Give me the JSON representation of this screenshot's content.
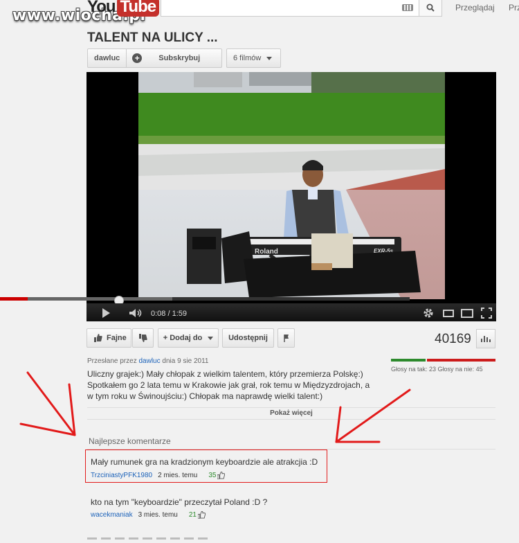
{
  "watermark": "www.wiocha.pl",
  "header": {
    "logo_you": "You",
    "logo_tube": "Tube",
    "search": {
      "value": "",
      "placeholder": ""
    },
    "nav": [
      "Przeglądaj",
      "Prz"
    ]
  },
  "video": {
    "title": "TALENT NA ULICY ...",
    "channel": "dawluc",
    "subscribe_label": "Subskrybuj",
    "videos_count_label": "6 filmów",
    "player": {
      "time_current": "0:08",
      "time_total": "1:59",
      "progress_fraction": 0.067,
      "buffered_fraction": 0.42,
      "keyboard_brand": "Roland",
      "keyboard_model": "EXR-5s"
    },
    "actions": {
      "like_label": "Fajne",
      "add_label": "+ Dodaj do",
      "share_label": "Udostępnij"
    },
    "views": "40169",
    "uploaded_prefix": "Przesłane przez",
    "uploaded_by": "dawluc",
    "uploaded_date": "dnia 9 sie 2011",
    "votes_text": "Głosy na tak: 23 Głosy na nie: 45",
    "likes": 23,
    "dislikes": 45,
    "description": "Uliczny grajek:) Mały chłopak z wielkim talentem, który przemierza Polskę:) Spotkałem go 2 lata temu w Krakowie jak grał, rok temu w Międzyzdrojach, a w tym roku w Świnoujściu:) Chłopak ma naprawdę wielki talent:)",
    "show_more_label": "Pokaż więcej"
  },
  "comments": {
    "section_title": "Najlepsze komentarze",
    "items": [
      {
        "text": "Mały rumunek gra na kradzionym keyboardzie ale atrakcjia :D",
        "author": "TrzciniastyPFK1980",
        "age": "2 mies. temu",
        "likes": "35"
      },
      {
        "text": "kto na tym \"keyboardzie\" przeczytał Poland :D ?",
        "author": "wacekmaniak",
        "age": "3 mies. temu",
        "likes": "21"
      }
    ]
  },
  "colors": {
    "annotation_red": "#e21a1a",
    "like_green": "#2d8a2d",
    "link_blue": "#1c62b9"
  }
}
